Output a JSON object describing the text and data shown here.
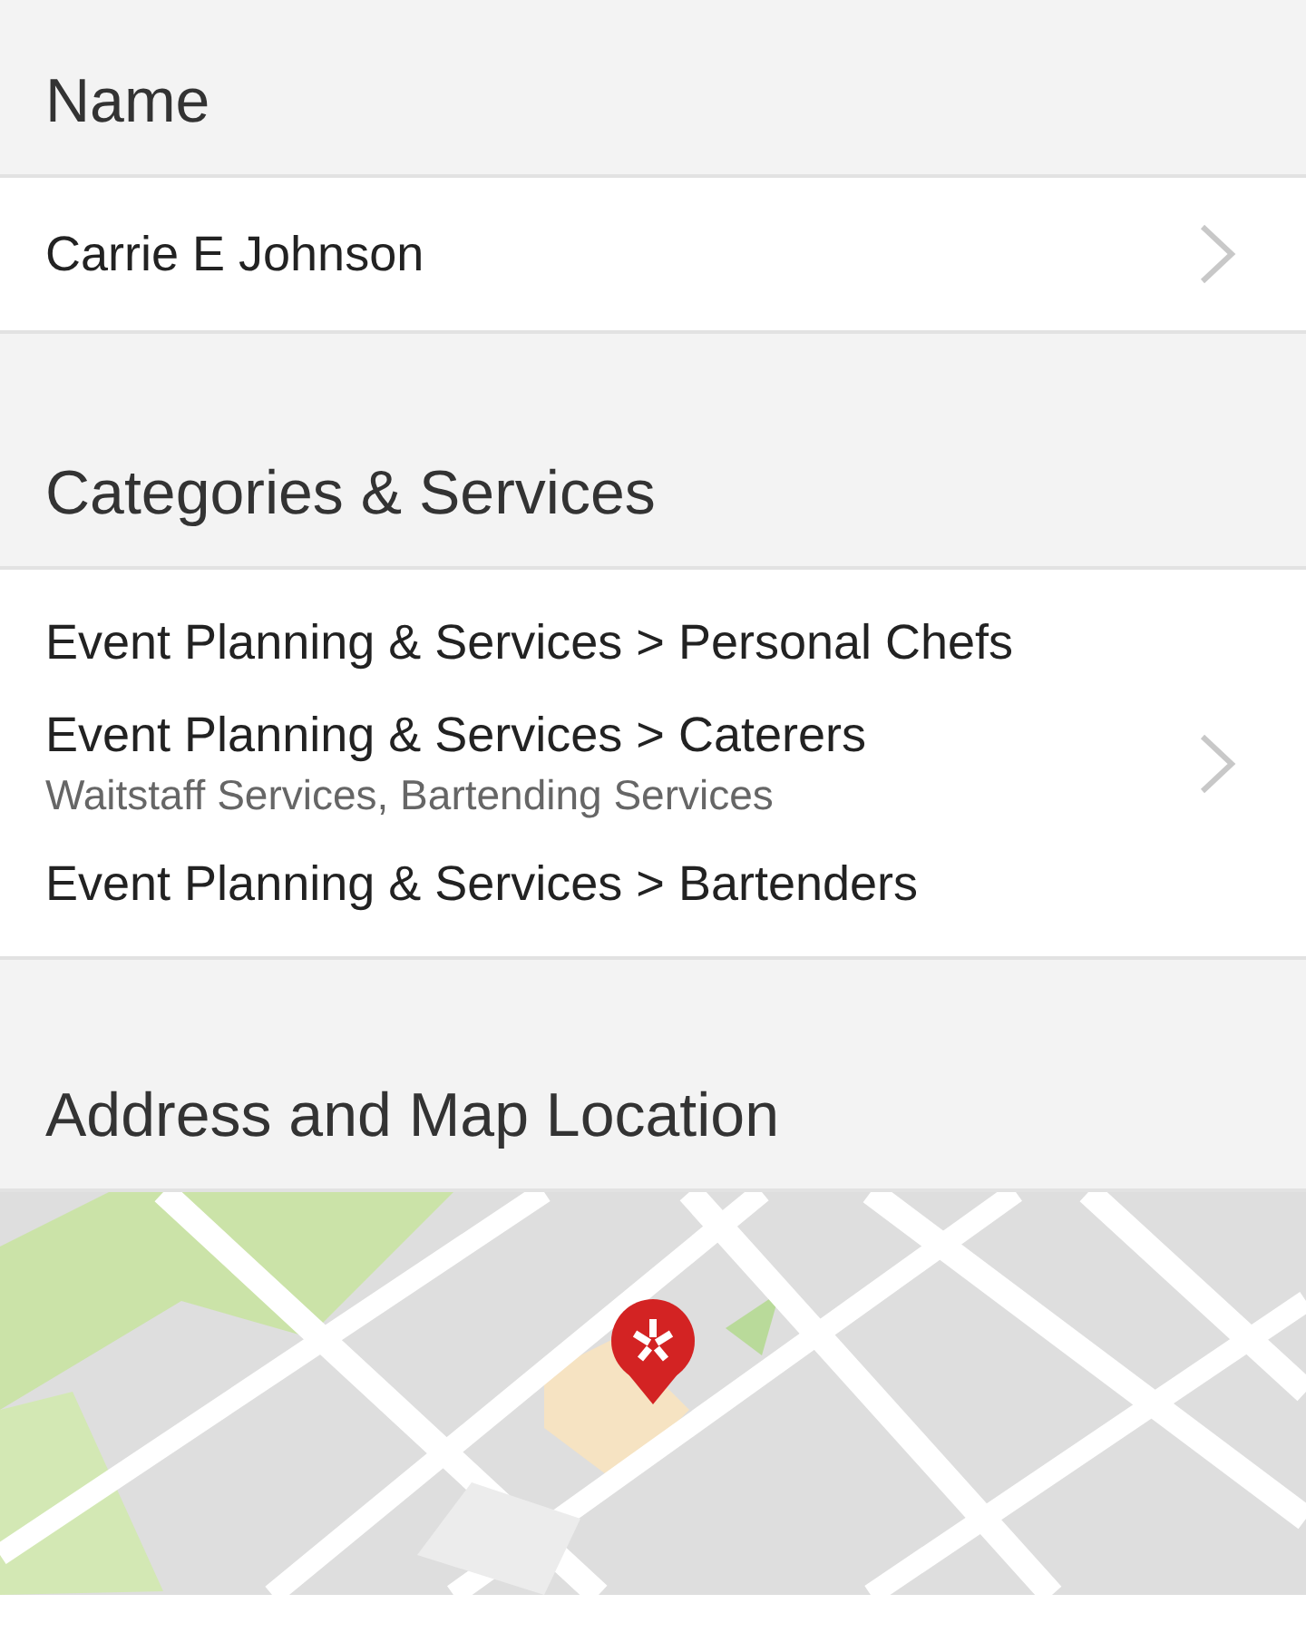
{
  "sections": [
    {
      "kind": "rows",
      "heading": "Name",
      "rows": [
        {
          "lines": [
            {
              "text": "Carrie E Johnson",
              "kind": "primary"
            }
          ]
        }
      ]
    },
    {
      "kind": "rows",
      "heading": "Categories & Services",
      "rows": [
        {
          "lines": [
            {
              "text": "Event Planning & Services > Personal Chefs",
              "kind": "primary"
            },
            {
              "text": "Event Planning & Services > Caterers",
              "kind": "primary"
            },
            {
              "text": "Waitstaff Services, Bartending Services",
              "kind": "secondary"
            },
            {
              "text": "Event Planning & Services > Bartenders",
              "kind": "primary"
            }
          ]
        }
      ]
    },
    {
      "kind": "map",
      "heading": "Address and Map Location"
    }
  ]
}
